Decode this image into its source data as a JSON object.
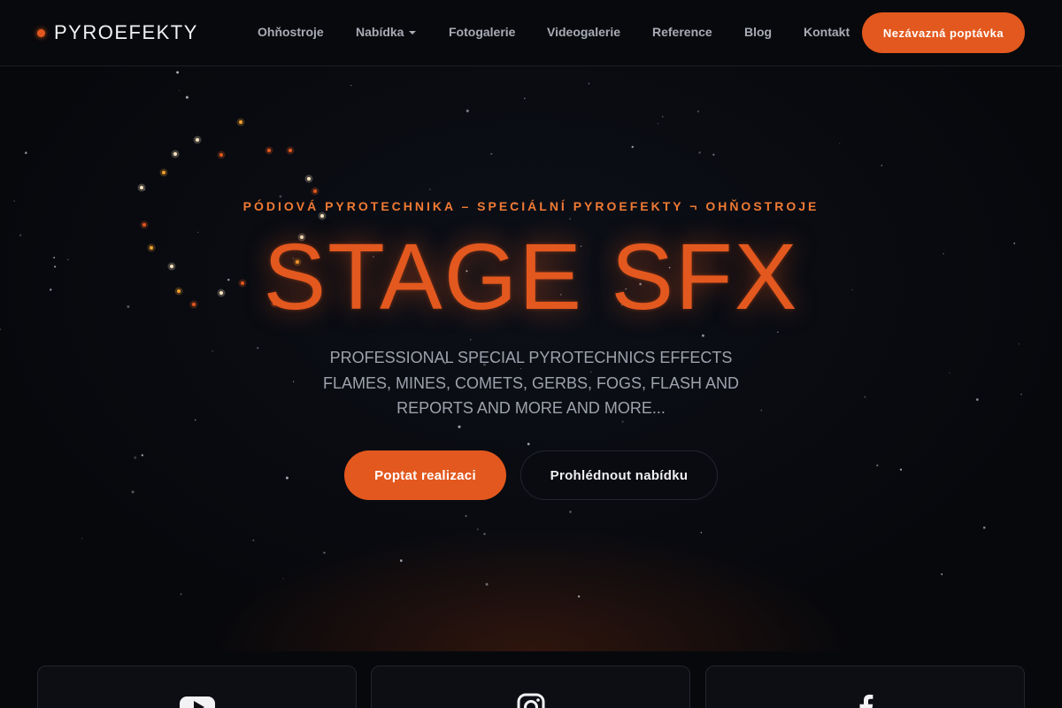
{
  "header": {
    "logo_text": "PYROEFEKTY",
    "nav": [
      {
        "label": "Ohňostroje",
        "has_dropdown": false
      },
      {
        "label": "Nabídka",
        "has_dropdown": true
      },
      {
        "label": "Fotogalerie",
        "has_dropdown": false
      },
      {
        "label": "Videogalerie",
        "has_dropdown": false
      },
      {
        "label": "Reference",
        "has_dropdown": false
      },
      {
        "label": "Blog",
        "has_dropdown": false
      },
      {
        "label": "Kontakt",
        "has_dropdown": false
      }
    ],
    "cta_label": "Nezávazná poptávka"
  },
  "hero": {
    "tagline": "PÓDIOVÁ PYROTECHNIKA – SPECIÁLNÍ PYROEFEKTY ¬ OHŇOSTROJE",
    "title": "STAGE SFX",
    "subtitle": "PROFESSIONAL SPECIAL PYROTECHNICS EFFECTS FLAMES, MINES, COMETS, GERBS, FOGS, FLASH AND REPORTS AND MORE AND MORE...",
    "primary_button": "Poptat realizaci",
    "secondary_button": "Prohlédnout nabídku"
  },
  "social_cards": [
    {
      "icon": "youtube-icon"
    },
    {
      "icon": "instagram-icon"
    },
    {
      "icon": "facebook-icon"
    }
  ],
  "colors": {
    "accent": "#e3581e",
    "background": "#07080c",
    "nav_text": "#a8abb4"
  }
}
